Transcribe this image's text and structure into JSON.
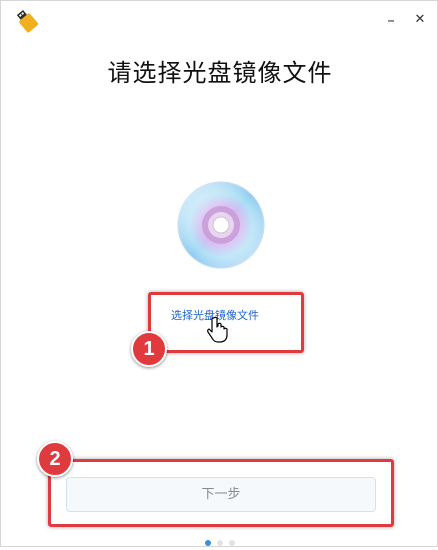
{
  "window": {
    "app_icon": "usb-drive-icon",
    "minimize_icon": "minimize-icon",
    "close_icon": "close-icon",
    "minimize_glyph": "–",
    "close_glyph": "✕"
  },
  "main": {
    "title": "请选择光盘镜像文件",
    "disc_icon": "optical-disc-icon",
    "select_link": "选择光盘镜像文件",
    "next_button": "下一步"
  },
  "annotations": [
    {
      "label": "1",
      "color": "#e0393e"
    },
    {
      "label": "2",
      "color": "#e0393e"
    }
  ],
  "pager": {
    "current_page": 1,
    "total_pages": 3,
    "active_color": "#3a8fdb"
  }
}
